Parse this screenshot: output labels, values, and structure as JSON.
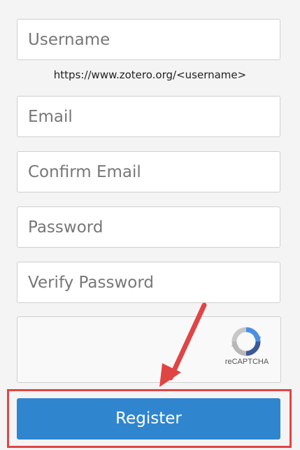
{
  "form": {
    "username_placeholder": "Username",
    "url_hint": "https://www.zotero.org/<username>",
    "email_placeholder": "Email",
    "confirm_email_placeholder": "Confirm Email",
    "password_placeholder": "Password",
    "verify_password_placeholder": "Verify Password",
    "recaptcha_label": "reCAPTCHA",
    "register_label": "Register"
  },
  "annotation": {
    "arrow_color": "#e04545",
    "highlight_color": "#e04545"
  },
  "colors": {
    "button": "#2f86cf",
    "background": "#f4f4f4"
  },
  "icons": {
    "recaptcha": "recaptcha-icon",
    "annotation_arrow": "arrow-icon"
  }
}
